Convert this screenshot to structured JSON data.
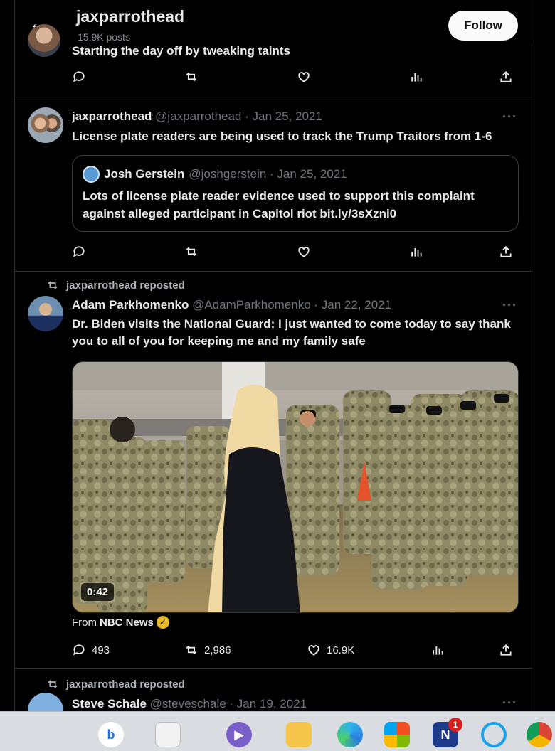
{
  "header": {
    "back_glyph": "←",
    "title": "jaxparrothead",
    "post_count": "15.9K posts",
    "follow_label": "Follow"
  },
  "post0": {
    "text": "Starting the day off by tweaking taints"
  },
  "post1": {
    "name": "jaxparrothead",
    "handle": "@jaxparrothead · Jan 25, 2021",
    "more": "···",
    "text": "License plate readers are being used to track the Trump Traitors from 1-6",
    "quote": {
      "name": "Josh Gerstein",
      "handle": "@joshgerstein · Jan 25, 2021",
      "text": "Lots of license plate reader evidence used to support this complaint against alleged participant in Capitol riot bit.ly/3sXzni0"
    }
  },
  "post2": {
    "repost_label": "jaxparrothead reposted",
    "name": "Adam Parkhomenko",
    "handle": "@AdamParkhomenko · Jan 22, 2021",
    "more": "···",
    "text": "Dr. Biden visits the National Guard: I just wanted to come today to say thank you to all of you for keeping me and my family safe",
    "video_time": "0:42",
    "from_label": "From",
    "from_source": "NBC News",
    "replies": "493",
    "reposts": "2,986",
    "likes": "16.9K"
  },
  "post3": {
    "repost_label": "jaxparrothead reposted",
    "name": "Steve Schale",
    "handle": "@steveschale · Jan 19, 2021",
    "more": "···"
  },
  "taskbar": {
    "items": [
      "start",
      "files",
      "meet",
      "explorer",
      "edge",
      "store",
      "news",
      "cortana",
      "chrome"
    ],
    "news_badge": "1"
  },
  "colors": {
    "background": "#000000",
    "text": "#e7e9ea",
    "muted": "#71767b",
    "border": "#2f3336",
    "verified": "#e7b829"
  }
}
